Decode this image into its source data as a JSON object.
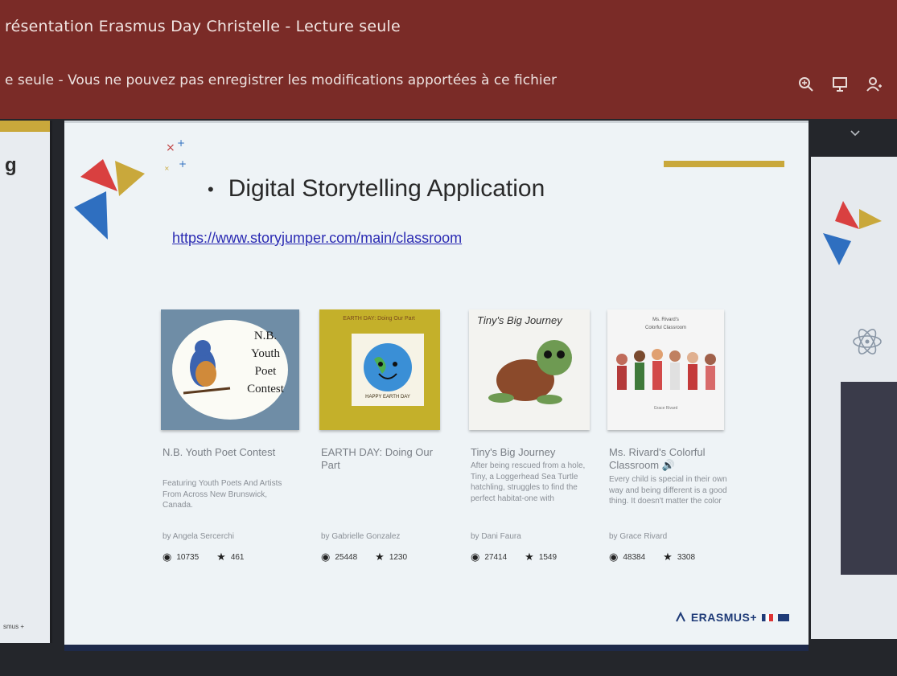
{
  "window": {
    "title": "résentation Erasmus Day Christelle - Lecture seule",
    "readonly_message": "e seule - Vous ne pouvez pas enregistrer les modifications apportées à ce fichier",
    "icons": [
      "zoom-in-icon",
      "present-icon",
      "add-user-icon"
    ]
  },
  "left_thumb": {
    "glyph": "g",
    "footer": "smus +"
  },
  "slide": {
    "bullet_title": "Digital Storytelling Application",
    "url": "https://www.storyjumper.com/main/classroom",
    "logo_badge": "ERASMUS+",
    "cards": [
      {
        "title": "N.B. Youth Poet Contest",
        "description": "Featuring Youth Poets And Artists From Across New Brunswick, Canada.",
        "author": "by Angela Sercerchi",
        "views": "10735",
        "stars": "461",
        "cover_text": [
          "N.B.",
          "Youth",
          "Poet",
          "Contest"
        ]
      },
      {
        "title": "EARTH DAY: Doing Our Part",
        "description": "",
        "author": "by Gabrielle Gonzalez",
        "views": "25448",
        "stars": "1230",
        "cover_text": [
          "EARTH DAY: Doing Our Part",
          "HAPPY EARTH DAY"
        ]
      },
      {
        "title": "Tiny's Big Journey",
        "description": "After being rescued from a hole, Tiny, a Loggerhead Sea Turtle hatchling, struggles to find the perfect habitat-one with",
        "author": "by Dani Faura",
        "views": "27414",
        "stars": "1549",
        "cover_text": [
          "Tiny's Big Journey"
        ]
      },
      {
        "title": "Ms. Rivard's Colorful Classroom",
        "description": "Every child is special in their own way and being different is a good thing. It doesn't matter the color",
        "author": "by Grace Rivard",
        "views": "48384",
        "stars": "3308",
        "cover_text": [
          "Ms. Rivard's",
          "Colorful Classroom",
          "Grace Rivard"
        ]
      }
    ]
  },
  "colors": {
    "titlebar": "#7a2b27",
    "slide_bg": "#eef3f6",
    "accent_gold": "#c9a83b",
    "accent_red": "#d94040",
    "accent_blue": "#2f6fc0",
    "link": "#2b2bb3"
  }
}
